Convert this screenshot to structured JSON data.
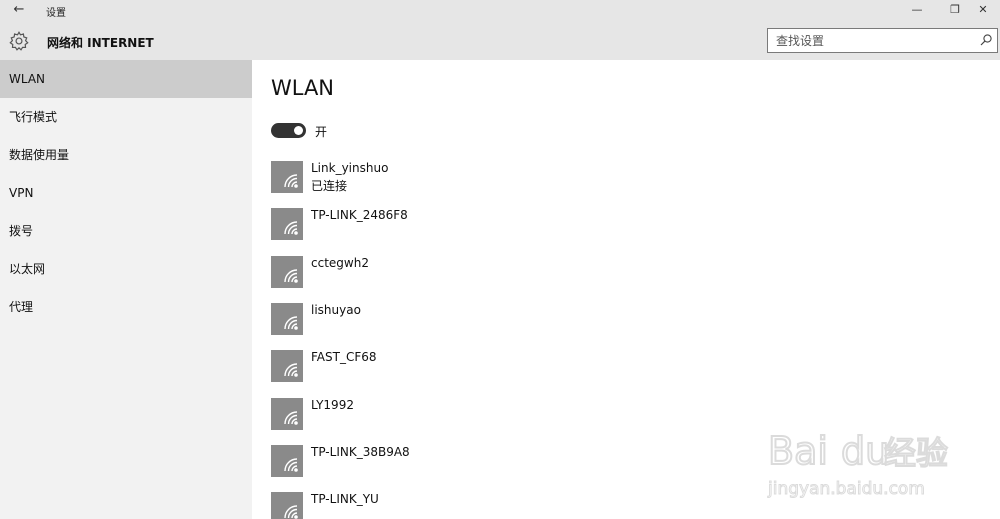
{
  "titlebar": {
    "back": "←",
    "title": "设置",
    "minimize": "—",
    "maximize": "❐",
    "close": "✕"
  },
  "header": {
    "icon": "gear-icon",
    "title": "网络和 INTERNET",
    "search_placeholder": "查找设置",
    "search_icon": "search-icon"
  },
  "sidebar": {
    "items": [
      {
        "label": "WLAN"
      },
      {
        "label": "飞行模式"
      },
      {
        "label": "数据使用量"
      },
      {
        "label": "VPN"
      },
      {
        "label": "拨号"
      },
      {
        "label": "以太网"
      },
      {
        "label": "代理"
      }
    ],
    "active_index": 0
  },
  "main": {
    "title": "WLAN",
    "toggle": {
      "state": "on",
      "label": "开"
    },
    "networks": [
      {
        "name": "Link_yinshuo",
        "status": "已连接",
        "icon": "wifi-icon"
      },
      {
        "name": "TP-LINK_2486F8",
        "icon": "wifi-icon"
      },
      {
        "name": "cctegwh2",
        "icon": "wifi-icon"
      },
      {
        "name": "lishuyao",
        "icon": "wifi-icon"
      },
      {
        "name": "FAST_CF68",
        "icon": "wifi-icon"
      },
      {
        "name": "LY1992",
        "icon": "wifi-icon"
      },
      {
        "name": "TP-LINK_38B9A8",
        "icon": "wifi-icon"
      },
      {
        "name": "TP-LINK_YU",
        "icon": "wifi-icon"
      }
    ]
  },
  "watermark": {
    "logo_text": "Bai du 经验",
    "url": "jingyan.baidu.com"
  },
  "colors": {
    "chrome": "#e6e6e6",
    "sidebar": "#f2f2f2",
    "sidebar_active": "#cccccc",
    "wifi_tile": "#8a8a8a",
    "toggle_on": "#333333"
  }
}
